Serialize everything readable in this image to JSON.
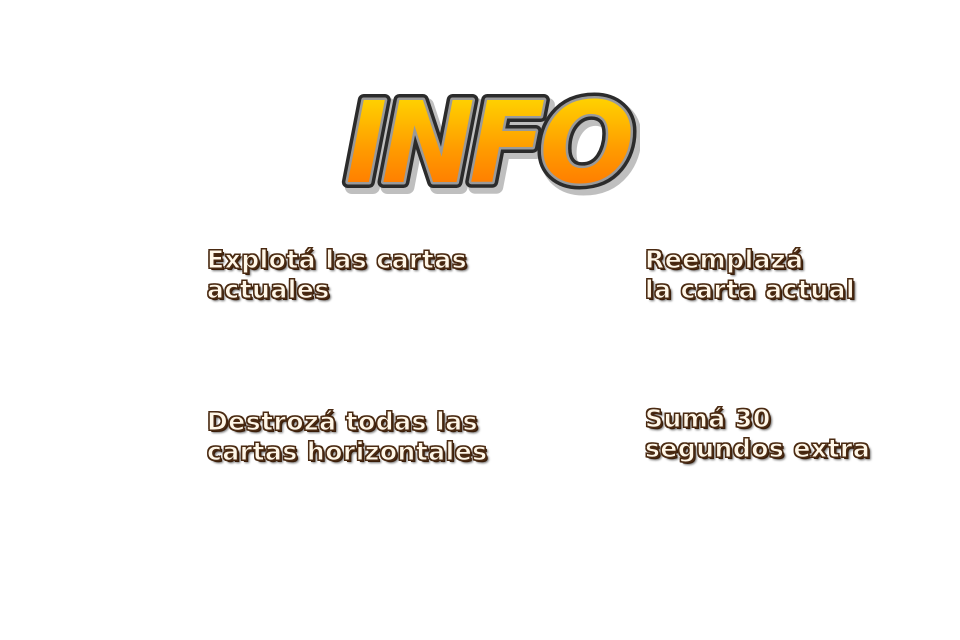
{
  "title": "INFO",
  "colors": {
    "title_top": "#ffe600",
    "title_bottom": "#ff6a00",
    "title_outline": "#2b2b2b",
    "tip_text": "#fff7e8",
    "tip_outline": "#4a2a12",
    "background": "#ffffff"
  },
  "tips": {
    "explode": {
      "line1": "Explotá las cartas",
      "line2": "actuales"
    },
    "replace": {
      "line1": "Reemplazá",
      "line2": "la carta actual"
    },
    "destroy": {
      "line1": "Destrozá todas las",
      "line2": "cartas horizontales"
    },
    "time": {
      "line1": "Sumá 30",
      "line2": "segundos extra"
    }
  }
}
